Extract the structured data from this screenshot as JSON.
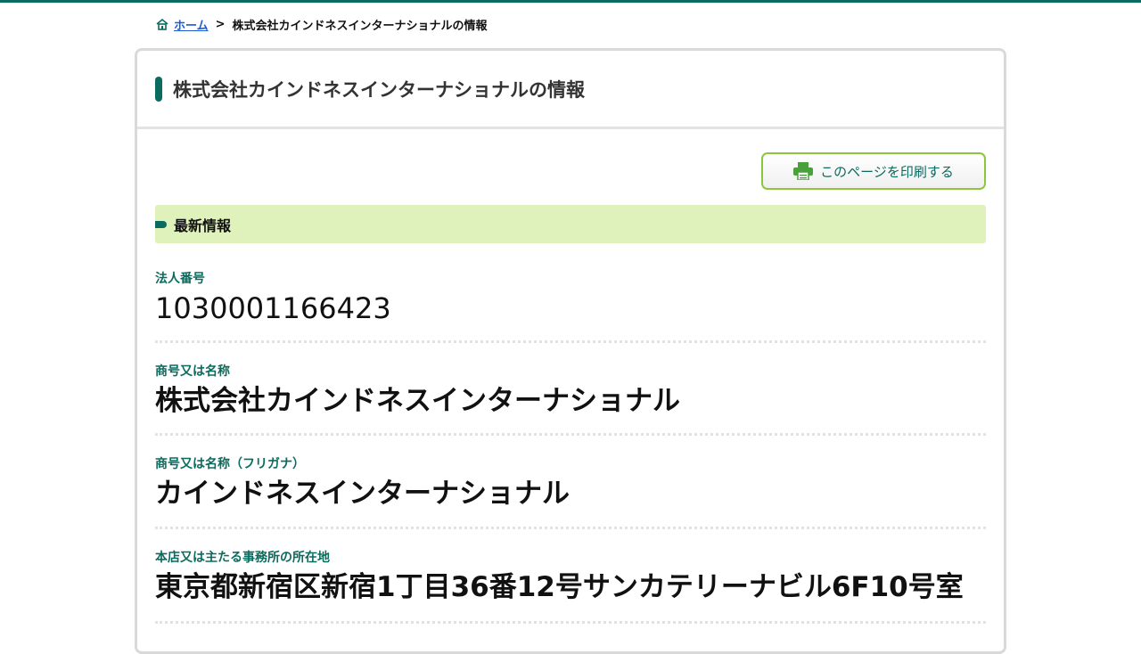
{
  "breadcrumb": {
    "home_label": "ホーム",
    "separator": ">",
    "current": "株式会社カインドネスインターナショナルの情報"
  },
  "page": {
    "title": "株式会社カインドネスインターナショナルの情報",
    "print_button_label": "このページを印刷する",
    "section_title": "最新情報"
  },
  "fields": [
    {
      "label": "法人番号",
      "value": "1030001166423"
    },
    {
      "label": "商号又は名称",
      "value": "株式会社カインドネスインターナショナル"
    },
    {
      "label": "商号又は名称（フリガナ）",
      "value": "カインドネスインターナショナル"
    },
    {
      "label": "本店又は主たる事務所の所在地",
      "value": "東京都新宿区新宿1丁目36番12号サンカテリーナビル6F10号室"
    }
  ],
  "colors": {
    "brand": "#0b6b5e",
    "link": "#1a5bd6",
    "section_bg": "#e0f2bb",
    "print_border": "#8cc63f"
  },
  "icons": {
    "home": "home-icon",
    "print": "printer-icon"
  }
}
